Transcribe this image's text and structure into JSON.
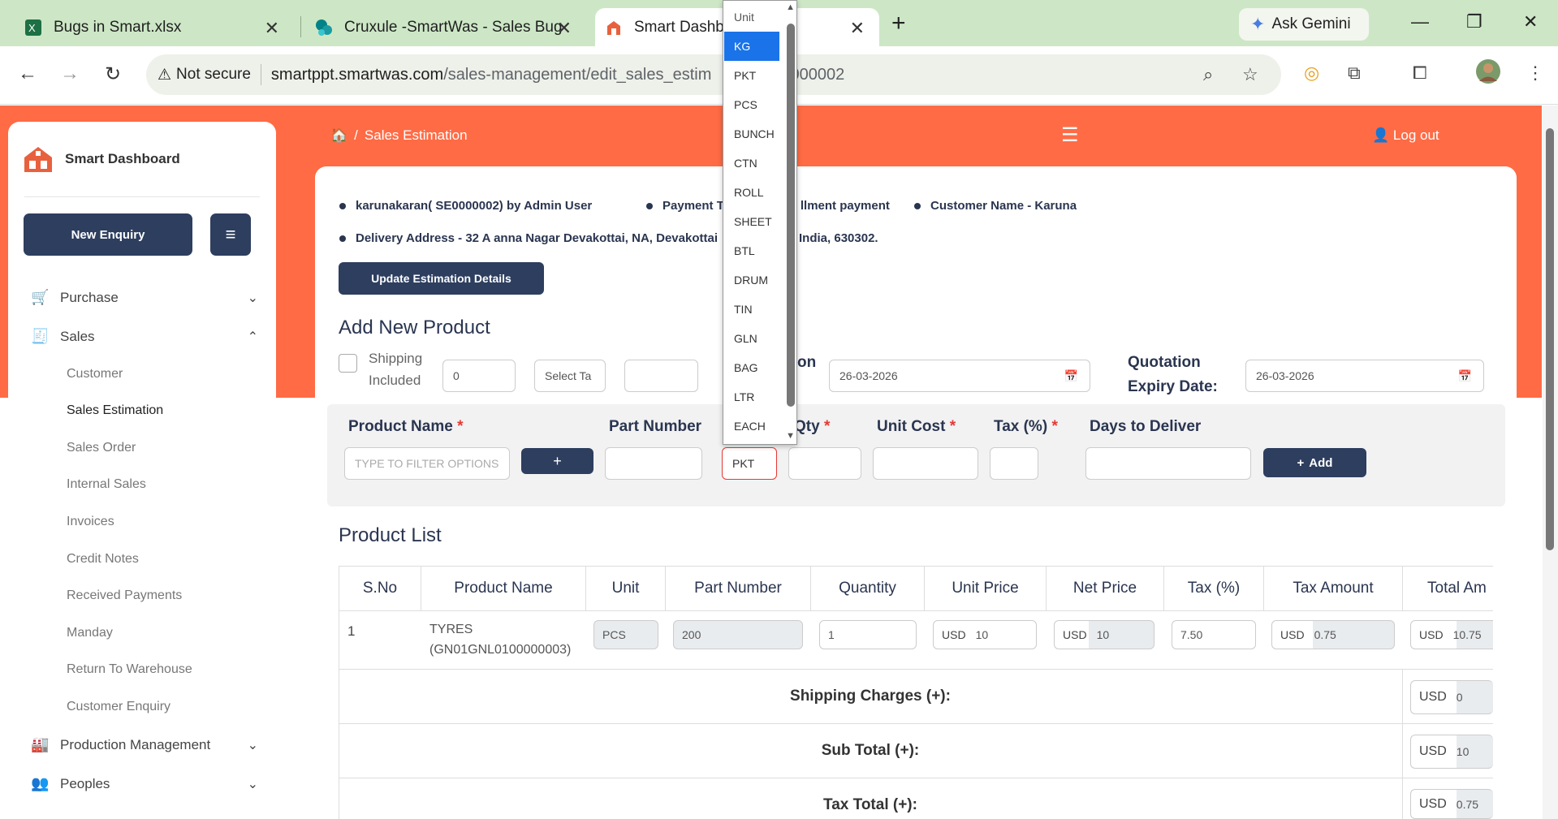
{
  "browser": {
    "tabs": [
      {
        "title": "Bugs in Smart.xlsx"
      },
      {
        "title": "Cruxule -SmartWas - Sales Bug"
      },
      {
        "title": "Smart Dashbo"
      }
    ],
    "gemini_label": "Ask Gemini",
    "not_secure": "Not secure",
    "url_host": "smartppt.smartwas.com",
    "url_path": "/sales-management/edit_sales_estim",
    "url_tail": "0000002"
  },
  "sidebar": {
    "brand": "Smart Dashboard",
    "new_enquiry": "New Enquiry",
    "groups": [
      {
        "label": "Purchase"
      },
      {
        "label": "Sales"
      },
      {
        "label": "Production Management"
      },
      {
        "label": "Peoples"
      }
    ],
    "sales_items": [
      {
        "label": "Customer"
      },
      {
        "label": "Sales Estimation"
      },
      {
        "label": "Sales Order"
      },
      {
        "label": "Internal Sales"
      },
      {
        "label": "Invoices"
      },
      {
        "label": "Credit Notes"
      },
      {
        "label": "Received Payments"
      },
      {
        "label": "Manday"
      },
      {
        "label": "Return To Warehouse"
      },
      {
        "label": "Customer Enquiry"
      }
    ]
  },
  "header": {
    "breadcrumb_sep": "/",
    "breadcrumb": "Sales Estimation",
    "logout": "Log out"
  },
  "info": {
    "estimation": "karunakaran( SE0000002) by Admin User",
    "payment_a": "Payment T",
    "payment_b": "llment payment",
    "customer": "Customer Name - Karuna",
    "address_a": "Delivery Address - 32 A anna Nagar Devakottai, NA, Devakottai",
    "address_b": "India, 630302.",
    "update_btn": "Update Estimation Details"
  },
  "add_product": {
    "title": "Add New Product",
    "shipping_label_1": "Shipping",
    "shipping_label_2": "Included",
    "shipping_value": "0",
    "tax_select": "Select Ta",
    "on_label": "on",
    "estimation_date": "26-03-2026",
    "expiry_label_1": "Quotation",
    "expiry_label_2": "Expiry Date:",
    "expiry_date": "26-03-2026",
    "product_name_label": "Product Name",
    "product_placeholder": "TYPE TO FILTER OPTIONS",
    "plus_btn": "+",
    "part_number_label": "Part Number",
    "qty_label": "Qty",
    "unit_cost_label": "Unit Cost",
    "tax_label": "Tax (%)",
    "days_label": "Days to Deliver",
    "add_btn": "Add",
    "unit_value": "PKT",
    "required_mark": "*"
  },
  "unit_dropdown": {
    "header": "Unit",
    "options": [
      "KG",
      "PKT",
      "PCS",
      "BUNCH",
      "CTN",
      "ROLL",
      "SHEET",
      "BTL",
      "DRUM",
      "TIN",
      "GLN",
      "BAG",
      "LTR",
      "EACH"
    ],
    "selected": "KG"
  },
  "product_list": {
    "title": "Product List",
    "columns": [
      "S.No",
      "Product Name",
      "Unit",
      "Part Number",
      "Quantity",
      "Unit Price",
      "Net Price",
      "Tax (%)",
      "Tax Amount",
      "Total Am"
    ],
    "row": {
      "sno": "1",
      "name_1": "TYRES",
      "name_2": "(GN01GNL0100000003)",
      "unit": "PCS",
      "part": "200",
      "qty": "1",
      "currency": "USD",
      "unit_price": "10",
      "net_price": "10",
      "tax": "7.50",
      "tax_amount": "0.75",
      "total": "10.75"
    },
    "summary": [
      {
        "label": "Shipping Charges (+):",
        "currency": "USD",
        "value": "0"
      },
      {
        "label": "Sub Total (+):",
        "currency": "USD",
        "value": "10"
      },
      {
        "label": "Tax Total (+):",
        "currency": "USD",
        "value": "0.75"
      }
    ]
  },
  "colors": {
    "accent": "#fe6b45",
    "navy": "#2d3e5f",
    "tabbar": "#cde7c6"
  }
}
